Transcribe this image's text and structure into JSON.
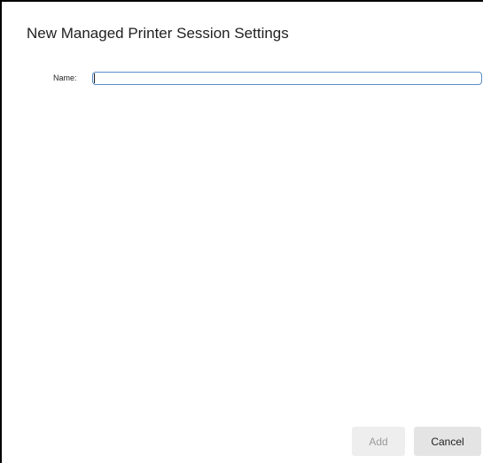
{
  "dialog": {
    "title": "New Managed Printer Session Settings",
    "name_label": "Name:",
    "name_value": "",
    "add_label": "Add",
    "cancel_label": "Cancel"
  },
  "colors": {
    "input_border": "#5a8dc8",
    "add_button_bg": "#eeeeee",
    "add_button_text_disabled": "#9b9b9b",
    "cancel_button_bg": "#e4e4e4"
  }
}
